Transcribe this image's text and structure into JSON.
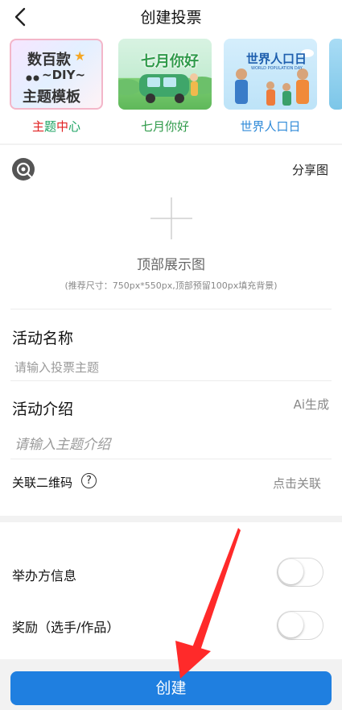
{
  "header": {
    "title": "创建投票"
  },
  "templates": {
    "thumb1_text": [
      "数百款",
      "~DIY~",
      "主题模板"
    ],
    "thumb2_text": "七月你好",
    "thumb3_title": "世界人口日",
    "thumb3_sub": "WORLD POPULATION DAY",
    "labels": [
      {
        "chars": [
          "主",
          "题",
          "中",
          "心"
        ],
        "colors": [
          "#e02020",
          "#1aa260",
          "#e02020",
          "#1aa260"
        ]
      },
      {
        "text": "七月你好",
        "color": "#2f9a4a"
      },
      {
        "text": "世界人口日",
        "color": "#2f8ad8"
      }
    ]
  },
  "share": {
    "label": "分享图"
  },
  "upload": {
    "title": "顶部展示图",
    "hint": "(推荐尺寸：750px*550px,顶部预留100px填充背景)"
  },
  "activity_name": {
    "label": "活动名称",
    "placeholder": "请输入投票主题"
  },
  "activity_intro": {
    "label": "活动介绍",
    "ai_label": "Ai生成",
    "placeholder": "请输入主题介绍"
  },
  "qrcode": {
    "label": "关联二维码",
    "help": "?",
    "action": "点击关联"
  },
  "organizer": {
    "label": "举办方信息"
  },
  "reward": {
    "label": "奖励（选手/作品）"
  },
  "submit": {
    "label": "创建"
  },
  "colors": {
    "primary": "#1f7fe0",
    "annotation_arrow": "#ff2a2a"
  }
}
